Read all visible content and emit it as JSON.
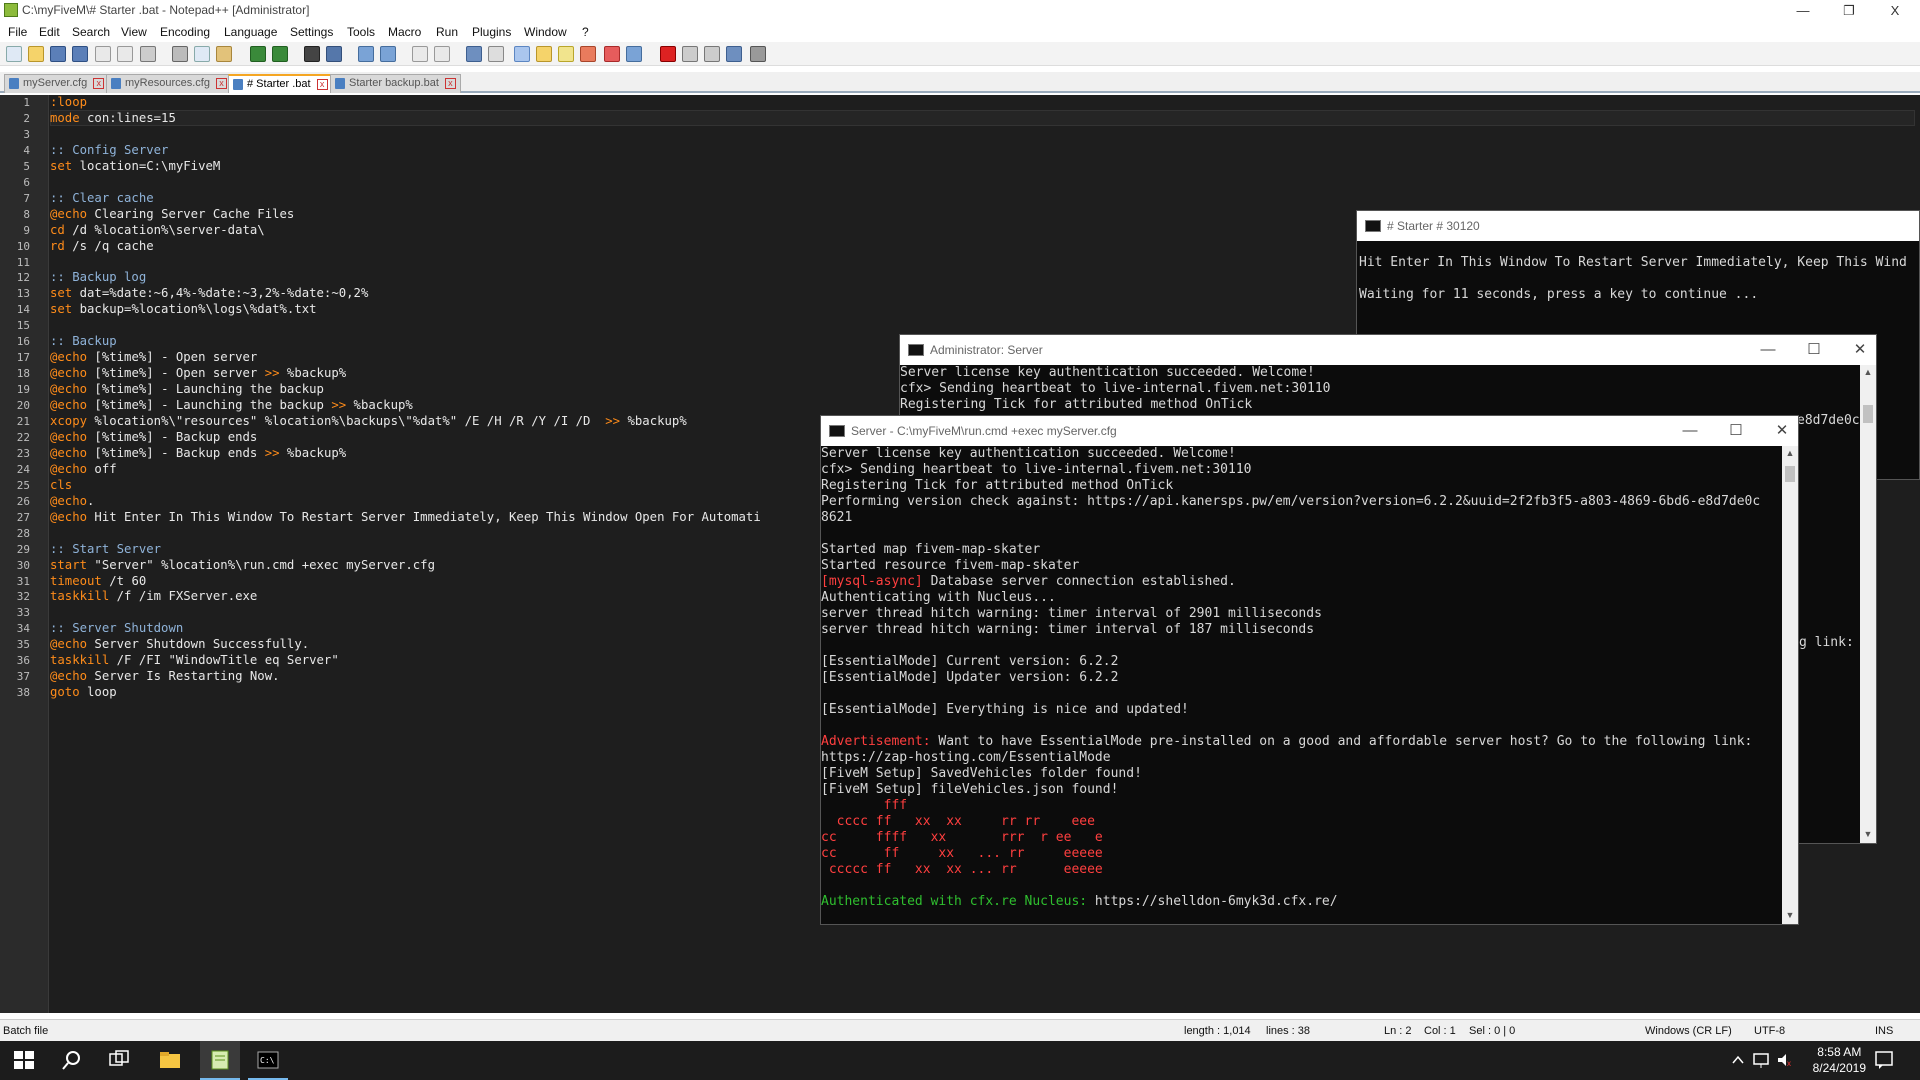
{
  "window": {
    "title": "C:\\myFiveM\\# Starter .bat - Notepad++ [Administrator]",
    "minimize": "—",
    "maximize": "❐",
    "close": "X"
  },
  "menu": [
    "File",
    "Edit",
    "Search",
    "View",
    "Encoding",
    "Language",
    "Settings",
    "Tools",
    "Macro",
    "Run",
    "Plugins",
    "Window",
    "?"
  ],
  "tabs": [
    {
      "label": "myServer.cfg",
      "active": false
    },
    {
      "label": "myResources.cfg",
      "active": false
    },
    {
      "label": "# Starter .bat",
      "active": true
    },
    {
      "label": "Starter backup.bat",
      "active": false
    }
  ],
  "tab_close": "x",
  "editor": {
    "lines": [
      ":loop",
      "mode con:lines=15",
      "",
      ":: Config Server",
      "set location=C:\\myFiveM",
      "",
      ":: Clear cache",
      "@echo Clearing Server Cache Files",
      "cd /d %location%\\server-data\\",
      "rd /s /q cache",
      "",
      ":: Backup log",
      "set dat=%date:~6,4%-%date:~3,2%-%date:~0,2%",
      "set backup=%location%\\logs\\%dat%.txt",
      "",
      ":: Backup",
      "@echo [%time%] - Open server",
      "@echo [%time%] - Open server >> %backup%",
      "@echo [%time%] - Launching the backup",
      "@echo [%time%] - Launching the backup >> %backup%",
      "xcopy %location%\\\"resources\" %location%\\backups\\\"%dat%\" /E /H /R /Y /I /D  >> %backup%",
      "@echo [%time%] - Backup ends",
      "@echo [%time%] - Backup ends >> %backup%",
      "@echo off",
      "cls",
      "@echo.",
      "@echo Hit Enter In This Window To Restart Server Immediately, Keep This Window Open For Automati",
      "",
      ":: Start Server",
      "start \"Server\" %location%\\run.cmd +exec myServer.cfg",
      "timeout /t 60",
      "taskkill /f /im FXServer.exe",
      "",
      ":: Server Shutdown",
      "@echo Server Shutdown Successfully.",
      "taskkill /F /FI \"WindowTitle eq Server\"",
      "@echo Server Is Restarting Now.",
      "goto loop"
    ]
  },
  "starter_console": {
    "title": "# Starter # 30120",
    "lines": [
      "Hit Enter In This Window To Restart Server Immediately, Keep This Wind",
      "",
      "Waiting for 11 seconds, press a key to continue ..."
    ]
  },
  "admin_console": {
    "title": "Administrator: Server",
    "lines": [
      "Server license key authentication succeeded. Welcome!",
      "cfx> Sending heartbeat to live-internal.fivem.net:30110",
      "Registering Tick for attributed method OnTick"
    ],
    "frag1": "e8d7de0c",
    "frag2": "g link:"
  },
  "server_console": {
    "title": "Server - C:\\myFiveM\\run.cmd  +exec myServer.cfg",
    "lines": [
      {
        "t": "Server license key authentication succeeded. Welcome!"
      },
      {
        "t": "cfx> Sending heartbeat to live-internal.fivem.net:30110"
      },
      {
        "t": "Registering Tick for attributed method OnTick"
      },
      {
        "t": "Performing version check against: https://api.kanersps.pw/em/version?version=6.2.2&uuid=2f2fb3f5-a803-4869-6bd6-e8d7de0c"
      },
      {
        "t": "8621"
      },
      {
        "t": ""
      },
      {
        "t": "Started map fivem-map-skater"
      },
      {
        "t": "Started resource fivem-map-skater"
      },
      {
        "p": "[mysql-async]",
        "pc": "red",
        "t": " Database server connection established."
      },
      {
        "t": "Authenticating with Nucleus..."
      },
      {
        "t": "server thread hitch warning: timer interval of 2901 milliseconds"
      },
      {
        "t": "server thread hitch warning: timer interval of 187 milliseconds"
      },
      {
        "t": ""
      },
      {
        "t": "[EssentialMode] Current version: 6.2.2"
      },
      {
        "t": "[EssentialMode] Updater version: 6.2.2"
      },
      {
        "t": ""
      },
      {
        "t": "[EssentialMode] Everything is nice and updated!"
      },
      {
        "t": ""
      },
      {
        "p": "Advertisement:",
        "pc": "red",
        "t": " Want to have EssentialMode pre-installed on a good and affordable server host? Go to the following link:"
      },
      {
        "t": "https://zap-hosting.com/EssentialMode"
      },
      {
        "t": "[FiveM Setup] SavedVehicles folder found!"
      },
      {
        "t": "[FiveM Setup] fileVehicles.json found!"
      },
      {
        "p": "        fff",
        "pc": "red",
        "t": ""
      },
      {
        "p": "  cccc ff   xx  xx     rr rr    eee",
        "pc": "red",
        "t": ""
      },
      {
        "p": "cc     ffff   xx       rrr  r ee   e",
        "pc": "red",
        "t": ""
      },
      {
        "p": "cc      ff     xx   ... rr     eeeee",
        "pc": "red",
        "t": ""
      },
      {
        "p": " ccccc ff   xx  xx ... rr      eeeee",
        "pc": "red",
        "t": ""
      },
      {
        "t": ""
      },
      {
        "p": "Authenticated with cfx.re Nucleus:",
        "pc": "grn",
        "t": " https://shelldon-6myk3d.cfx.re/"
      }
    ]
  },
  "status": {
    "filetype": "Batch file",
    "length": "length : 1,014",
    "lines": "lines : 38",
    "ln": "Ln : 2",
    "col": "Col : 1",
    "sel": "Sel : 0 | 0",
    "eol": "Windows (CR LF)",
    "encoding": "UTF-8",
    "mode": "INS"
  },
  "taskbar": {
    "time": "8:58 AM",
    "date": "8/24/2019"
  }
}
